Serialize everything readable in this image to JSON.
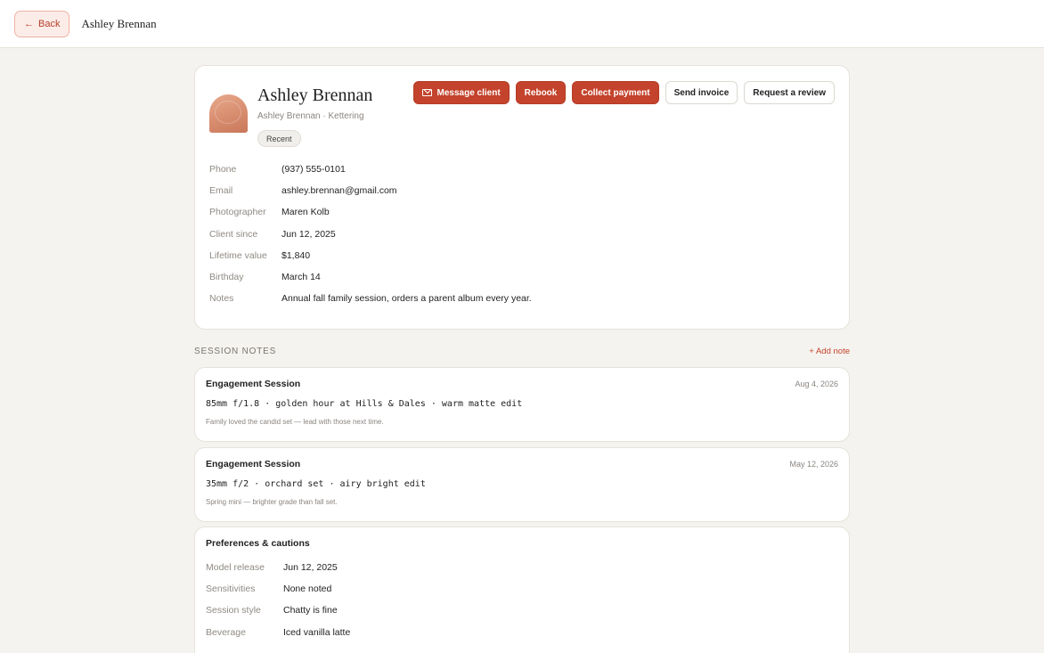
{
  "topbar": {
    "back_label": "Back",
    "client_name": "Ashley Brennan"
  },
  "profile": {
    "name": "Ashley Brennan",
    "subtitle": "Ashley Brennan · Kettering",
    "badge": "Recent",
    "actions": {
      "message": "Message client",
      "rebook": "Rebook",
      "collect": "Collect payment",
      "invoice": "Send invoice",
      "review": "Request a review"
    },
    "fields": [
      {
        "label": "Phone",
        "value": "(937) 555-0101"
      },
      {
        "label": "Email",
        "value": "ashley.brennan@gmail.com"
      },
      {
        "label": "Photographer",
        "value": "Maren Kolb"
      },
      {
        "label": "Client since",
        "value": "Jun 12, 2025"
      },
      {
        "label": "Lifetime value",
        "value": "$1,840"
      },
      {
        "label": "Birthday",
        "value": "March 14"
      },
      {
        "label": "Notes",
        "value": "Annual fall family session, orders a parent album every year."
      }
    ]
  },
  "session_notes": {
    "title": "SESSION NOTES",
    "add_label": "+ Add note",
    "items": [
      {
        "title": "Engagement Session",
        "date": "Aug 4, 2026",
        "settings": "85mm f/1.8 · golden hour at Hills & Dales · warm matte edit",
        "note": "Family loved the candid set — lead with those next time."
      },
      {
        "title": "Engagement Session",
        "date": "May 12, 2026",
        "settings": "35mm f/2 · orchard set · airy bright edit",
        "note": "Spring mini — brighter grade than fall set."
      }
    ]
  },
  "preferences": {
    "title": "Preferences & cautions",
    "fields": [
      {
        "label": "Model release",
        "value": "Jun 12, 2025"
      },
      {
        "label": "Sensitivities",
        "value": "None noted"
      },
      {
        "label": "Session style",
        "value": "Chatty is fine"
      },
      {
        "label": "Beverage",
        "value": "Iced vanilla latte"
      }
    ]
  },
  "colors": {
    "accent": "#c4432c",
    "background": "#f5f3ef"
  }
}
